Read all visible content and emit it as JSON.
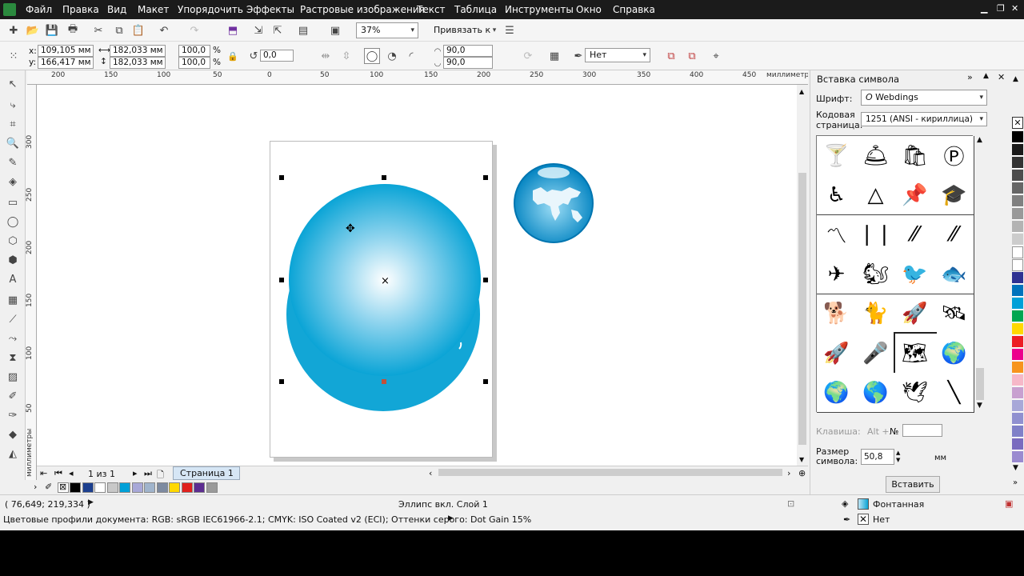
{
  "menu": [
    "Файл",
    "Правка",
    "Вид",
    "Макет",
    "Упорядочить",
    "Эффекты",
    "Растровые изображения",
    "Текст",
    "Таблица",
    "Инструменты",
    "Окно",
    "Справка"
  ],
  "toolbar": {
    "zoom": "37%",
    "snap": "Привязать к"
  },
  "props": {
    "x": "109,105 мм",
    "y": "166,417 мм",
    "w": "182,033 мм",
    "h": "182,033 мм",
    "sx": "100,0",
    "sy": "100,0",
    "pct": "%",
    "angle": "0,0",
    "arc1": "90,0",
    "arc2": "90,0",
    "outline": "Нет"
  },
  "ruler": {
    "h": [
      "200",
      "150",
      "100",
      "50",
      "0",
      "50",
      "100",
      "150",
      "200",
      "250",
      "300",
      "350",
      "400",
      "450"
    ],
    "v": [
      "300",
      "250",
      "200",
      "150",
      "100",
      "50"
    ],
    "unit": "миллиметры"
  },
  "pagebar": {
    "counter": "1 из 1",
    "tab": "Страница 1"
  },
  "status": {
    "coords": "( 76,649; 219,334 )",
    "object": "Эллипс вкл. Слой 1",
    "profiles": "Цветовые профили документа: RGB: sRGB IEC61966-2.1; CMYK: ISO Coated v2 (ECI); Оттенки серого: Dot Gain 15%",
    "fill_label": "Фонтанная",
    "outline_label": "Нет"
  },
  "docker": {
    "title": "Вставка символа",
    "font_label": "Шрифт:",
    "font_value": "Webdings",
    "codepage_label1": "Кодовая",
    "codepage_label2": "страница:",
    "codepage_value": "1251 (ANSI - кириллица)",
    "key_label": "Клавиша:",
    "key_alt": "Alt +",
    "key_no": "№",
    "size_label1": "Размер",
    "size_label2": "символа:",
    "size_value": "50,8",
    "size_unit": "мм",
    "insert_button": "Вставить",
    "glyphs": [
      "🍸",
      "🛎",
      "🛍",
      "Ⓟ",
      "♿",
      "△",
      "📌",
      "🎓",
      "〽",
      "❘❘",
      "⁄⁄",
      "⁄⁄",
      "✈",
      "🐿",
      "🐦",
      "🐟",
      "🐕",
      "🐈",
      "🚀",
      "🛰",
      "🚀",
      "🎤",
      "🗺",
      "🌍",
      "🌍",
      "🌎",
      "🕊",
      "╲"
    ]
  },
  "colors": {
    "accent": "#00a0d8",
    "sphere_dark": "#0095c8",
    "palette": [
      "#000000",
      "#1c3f8f",
      "#ffffff",
      "#c8c8c8",
      "#00a0d8",
      "#a8a8d8",
      "#a0b4cc",
      "#7d8aa0",
      "#ffd800",
      "#e0201c",
      "#5c2d91",
      "#9a9a9a"
    ],
    "right_palette": [
      "#000000",
      "#1a1a1a",
      "#333333",
      "#4d4d4d",
      "#666666",
      "#808080",
      "#999999",
      "#b3b3b3",
      "#cccccc",
      "#ffffff",
      "#ffffff",
      "#2e3192",
      "#0072bc",
      "#00a0d8",
      "#00a651",
      "#ffd800",
      "#ed1c24",
      "#ec008c",
      "#f7941d",
      "#f6b8c8",
      "#c8a0d0",
      "#a8a8d8",
      "#9090d0",
      "#8080c8",
      "#7a6bbf",
      "#9a8ad0"
    ]
  }
}
